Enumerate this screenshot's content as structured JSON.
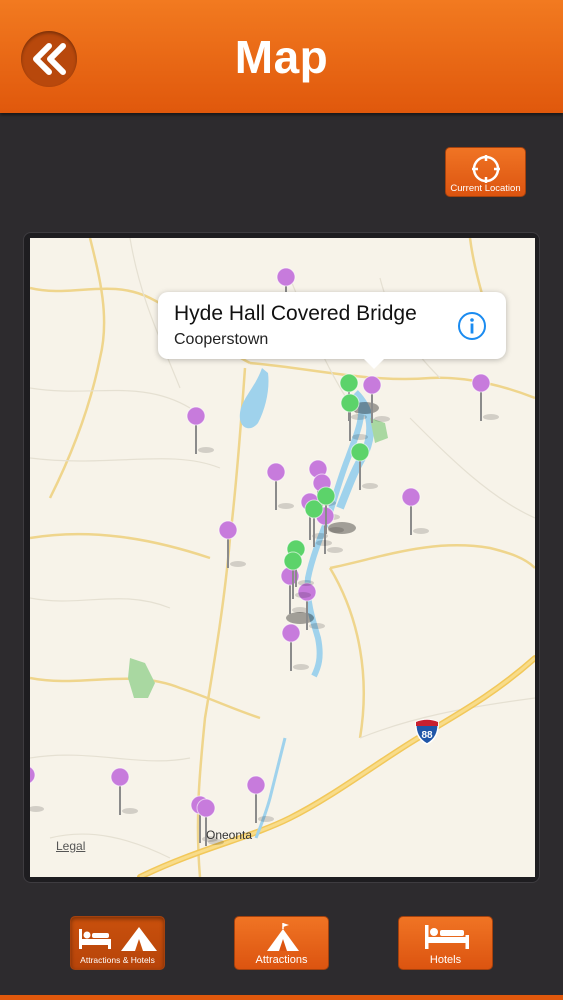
{
  "header": {
    "title": "Map",
    "back_icon": "double-chevron-left-icon"
  },
  "toolbar": {
    "current_location_label": "Current Location",
    "current_location_icon": "crosshair-icon"
  },
  "map": {
    "callout": {
      "title": "Hyde Hall Covered Bridge",
      "subtitle": "Cooperstown",
      "info_icon": "info-circle-icon"
    },
    "city_label": "Oneonta",
    "highway_label": "88",
    "legal_label": "Legal",
    "pin_colors": {
      "attraction": "#c77bdc",
      "hotel": "#5cd36a"
    }
  },
  "tabs": [
    {
      "label": "Attractions & Hotels",
      "icon": "bed-and-tent-icon",
      "selected": true
    },
    {
      "label": "Attractions",
      "icon": "tent-icon",
      "selected": false
    },
    {
      "label": "Hotels",
      "icon": "bed-icon",
      "selected": false
    }
  ],
  "colors": {
    "brand": "#e0580c",
    "background": "#2d2b2e"
  }
}
